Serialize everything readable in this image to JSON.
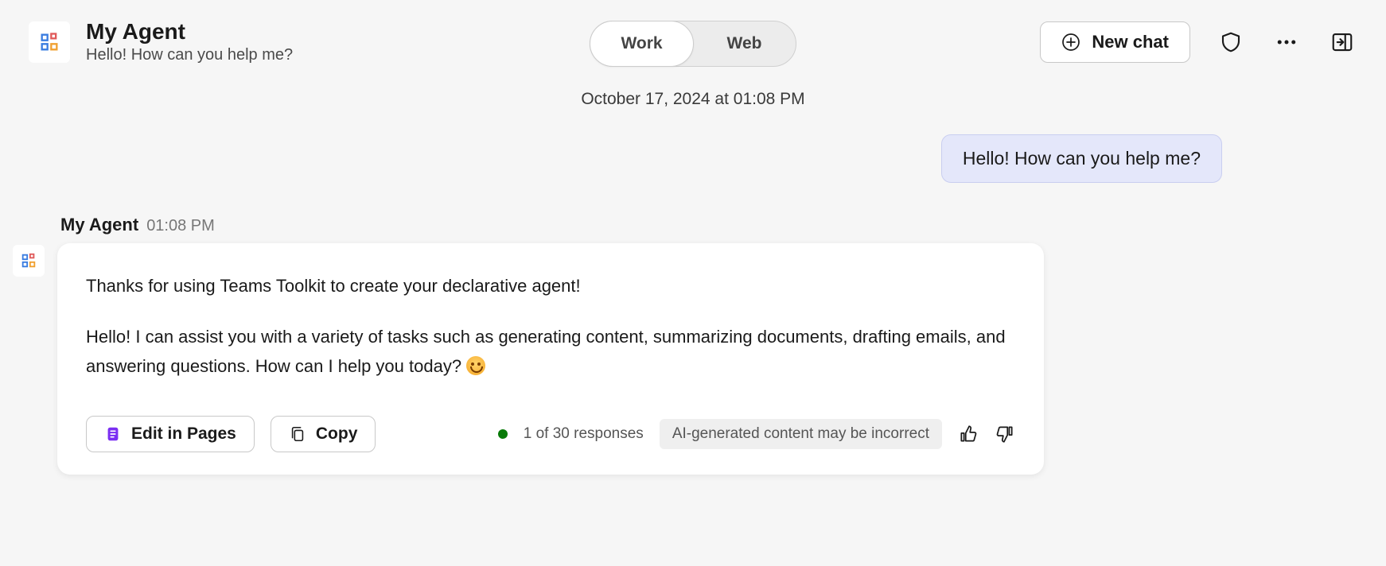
{
  "header": {
    "agent_name": "My Agent",
    "agent_subtitle": "Hello! How can you help me?",
    "toggle": {
      "work_label": "Work",
      "web_label": "Web",
      "active": "work"
    },
    "new_chat_label": "New chat"
  },
  "conversation": {
    "date_line": "October 17, 2024 at 01:08 PM",
    "user_message": "Hello! How can you help me?",
    "agent": {
      "name": "My Agent",
      "time": "01:08 PM",
      "paragraph1": "Thanks for using Teams Toolkit to create your declarative agent!",
      "paragraph2": "Hello! I can assist you with a variety of tasks such as generating content, summarizing documents, drafting emails, and answering questions. How can I help you today? "
    },
    "footer": {
      "edit_label": "Edit in Pages",
      "copy_label": "Copy",
      "response_count": "1 of 30 responses",
      "disclaimer": "AI-generated content may be incorrect"
    }
  }
}
